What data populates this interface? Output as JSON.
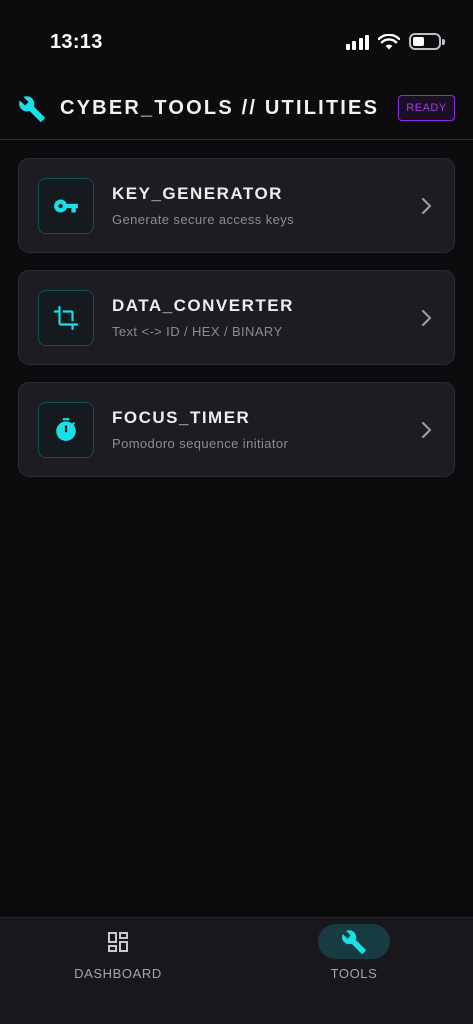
{
  "status_bar": {
    "time": "13:13",
    "icons": [
      "signal-icon",
      "wifi-icon",
      "battery-icon"
    ],
    "battery_level": 0.45
  },
  "header": {
    "icon": "wrench-icon",
    "title": "CYBER_TOOLS // UTILITIES",
    "badge": "READY"
  },
  "tools": [
    {
      "title": "KEY_GENERATOR",
      "description": "Generate secure access keys",
      "icon": "key-icon"
    },
    {
      "title": "DATA_CONVERTER",
      "description": "Text <-> ID / HEX / BINARY",
      "icon": "crop-icon"
    },
    {
      "title": "FOCUS_TIMER",
      "description": "Pomodoro sequence initiator",
      "icon": "timer-icon"
    }
  ],
  "bottom_nav": {
    "items": [
      {
        "label": "DASHBOARD",
        "icon": "dashboard-icon",
        "active": false
      },
      {
        "label": "TOOLS",
        "icon": "wrench-icon",
        "active": true
      }
    ]
  },
  "colors": {
    "background": "#0c0c0f",
    "card": "#1c1c22",
    "accent_cyan": "#19e0e6",
    "badge_purple": "#8a2be2",
    "active_nav_bg": "#173b40"
  }
}
